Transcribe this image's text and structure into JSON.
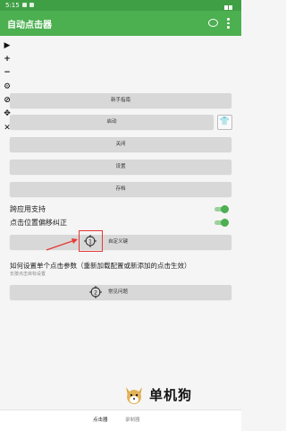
{
  "status": {
    "time": "5:15"
  },
  "app": {
    "title": "自动点击器"
  },
  "toolbar": {
    "icons": [
      "play-icon",
      "plus-icon",
      "minus-icon",
      "gear-icon",
      "eye-off-icon",
      "move-icon",
      "close-icon"
    ],
    "glyphs": [
      "▶",
      "+",
      "−",
      "⚙",
      "⊘",
      "✥",
      "✕"
    ]
  },
  "buttons": {
    "guide": "新手指南",
    "start": "启动",
    "close": "关闭",
    "settings": "设置",
    "archive": "存档",
    "custom_action": "自定义键",
    "common_issues": "常见问题"
  },
  "toggles": {
    "cross_app": {
      "label": "跨应用支持",
      "on": true
    },
    "offset_fix": {
      "label": "点击位置偏移纠正",
      "on": true
    }
  },
  "params": {
    "title": "如何设置单个点击参数（重新加载配置或新添加的点击生效）",
    "subtitle": "长按点击目标设置"
  },
  "markers": {
    "one": "1",
    "two": "2"
  },
  "watermark": {
    "text": "单机狗"
  },
  "bottom_nav": {
    "clicker": "点击器",
    "recorder": "录制器"
  },
  "colors": {
    "primary": "#4caf50",
    "status": "#3f9f45",
    "highlight": "#e53935"
  }
}
